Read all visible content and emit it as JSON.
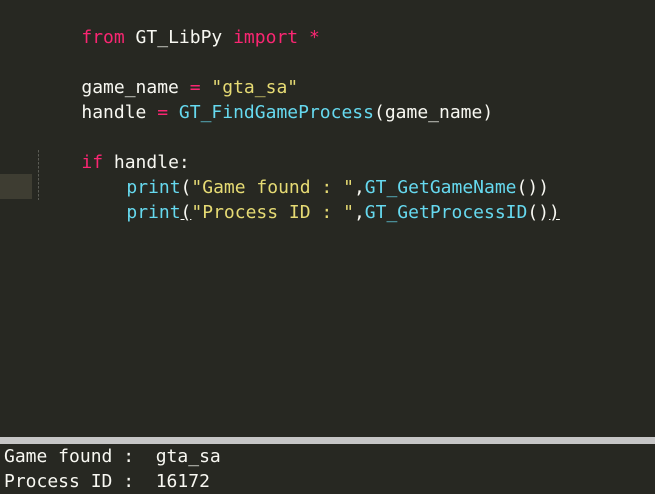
{
  "editor": {
    "language": "python",
    "line1": {
      "kw_from": "from",
      "module": " GT_LibPy ",
      "kw_import": "import",
      "star": " *"
    },
    "line3": {
      "var": "game_name",
      "op": " = ",
      "value": "\"gta_sa\""
    },
    "line4": {
      "var": "handle",
      "op": " = ",
      "func": "GT_FindGameProcess",
      "args": "(game_name)"
    },
    "line6": {
      "kw_if": "if",
      "cond": " handle:"
    },
    "line7": {
      "func": "print",
      "open": "(",
      "str": "\"Game found : \"",
      "comma": ",",
      "call": "GT_GetGameName",
      "close": "())"
    },
    "line8": {
      "func": "print",
      "open": "(",
      "str": "\"Process ID : \"",
      "comma": ",",
      "call": "GT_GetProcessID",
      "close_inner": "()",
      "close_outer": ")"
    }
  },
  "console": {
    "lines": [
      "Game found :  gta_sa",
      "Process ID :  16172"
    ]
  },
  "colors": {
    "background": "#272822",
    "keyword": "#f92672",
    "function": "#66d9ef",
    "string": "#e6db74",
    "text": "#f8f8f2",
    "divider": "#c6c6c6"
  }
}
